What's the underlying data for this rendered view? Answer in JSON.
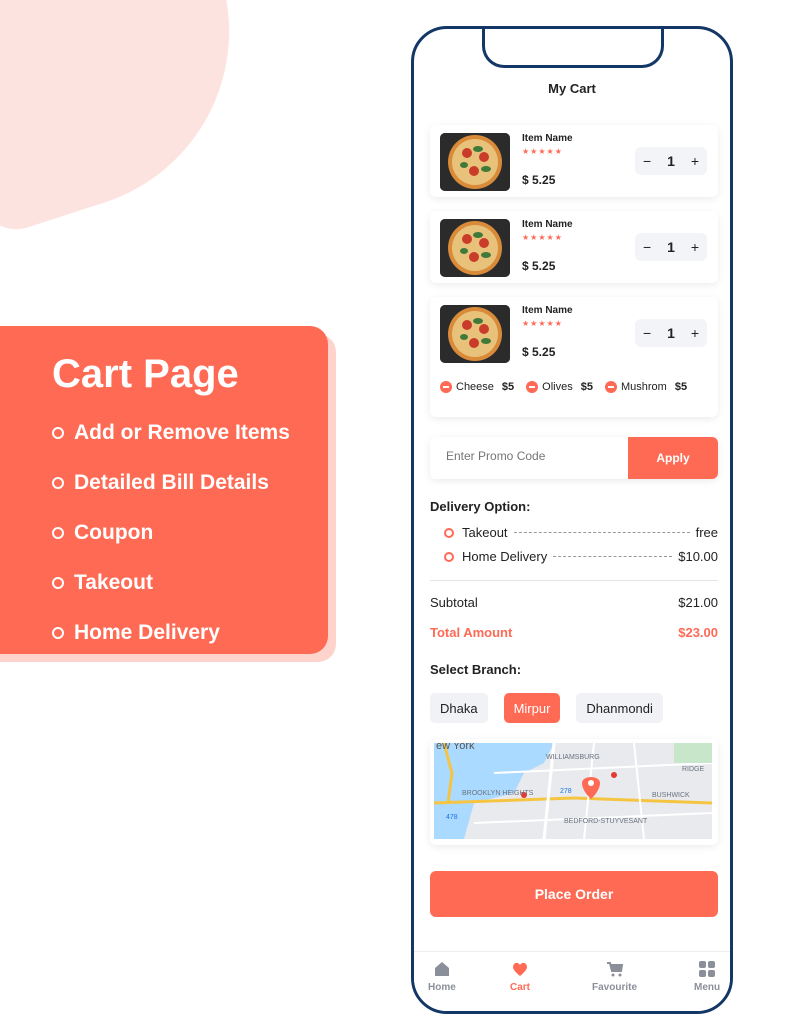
{
  "promo": {
    "title": "Cart Page",
    "features": [
      "Add or Remove Items",
      "Detailed Bill Details",
      "Coupon",
      "Takeout",
      "Home Delivery"
    ]
  },
  "cart": {
    "title": "My Cart",
    "items": [
      {
        "name": "Item Name",
        "price": "$ 5.25",
        "qty": "1",
        "rating": "★★★★★"
      },
      {
        "name": "Item Name",
        "price": "$ 5.25",
        "qty": "1",
        "rating": "★★★★★"
      },
      {
        "name": "Item Name",
        "price": "$ 5.25",
        "qty": "1",
        "rating": "★★★★★"
      }
    ],
    "extras": [
      {
        "name": "Cheese",
        "price": "$5"
      },
      {
        "name": "Olives",
        "price": "$5"
      },
      {
        "name": "Mushrom",
        "price": "$5"
      }
    ],
    "stepper_minus": "−",
    "stepper_plus": "+"
  },
  "promo_code": {
    "placeholder": "Enter Promo Code",
    "apply_label": "Apply"
  },
  "delivery": {
    "label": "Delivery Option:",
    "options": [
      {
        "name": "Takeout",
        "price": "free"
      },
      {
        "name": "Home Delivery",
        "price": "$10.00"
      }
    ]
  },
  "summary": {
    "subtotal_label": "Subtotal",
    "subtotal_value": "$21.00",
    "total_label": "Total Amount",
    "total_value": "$23.00"
  },
  "branch": {
    "label": "Select Branch:",
    "options": [
      "Dhaka",
      "Mirpur",
      "Dhanmondi"
    ],
    "selected": "Mirpur"
  },
  "map": {
    "labels": [
      "ew York",
      "WILLIAMSBURG",
      "RIDGE",
      "BROOKLYN HEIGHTS",
      "BUSHWICK",
      "BEDFORD-STUYVESANT",
      "278",
      "478"
    ]
  },
  "place_order": "Place Order",
  "nav": {
    "items": [
      "Home",
      "Cart",
      "Favourite",
      "Menu"
    ],
    "active": "Cart"
  },
  "colors": {
    "accent": "#ff6a55",
    "phone_frame": "#133766"
  }
}
